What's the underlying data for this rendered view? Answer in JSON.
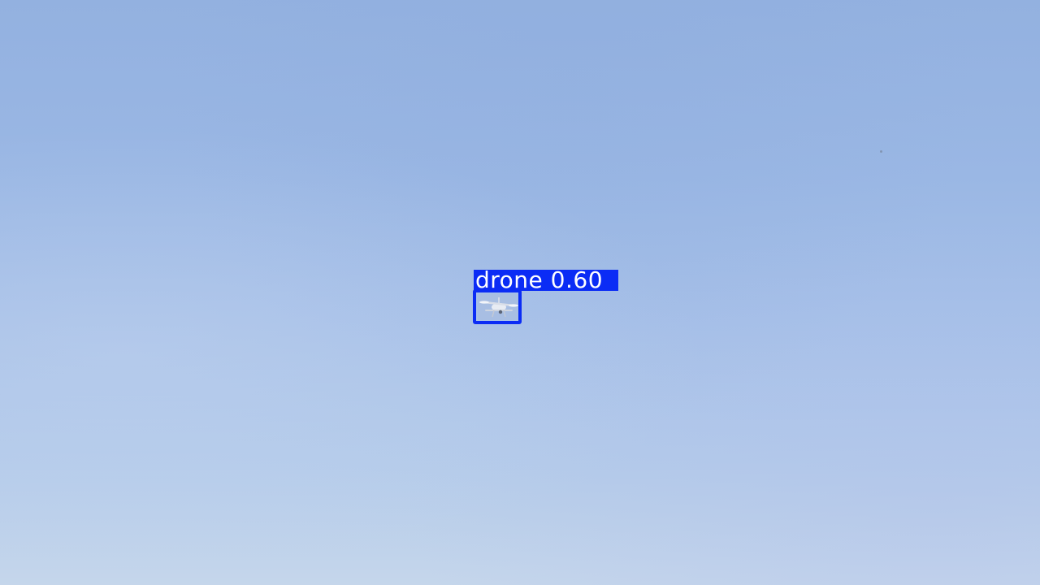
{
  "scene": {
    "description_icon": "sky-background",
    "colors": {
      "sky_top": "#93b1e0",
      "sky_bottom": "#c5d6eb",
      "box_color": "#0b2cf5",
      "label_text_color": "#ffffff"
    }
  },
  "detection": {
    "class_name": "drone",
    "confidence": "0.60",
    "label": "drone 0.60",
    "object_icon": "drone-icon"
  }
}
